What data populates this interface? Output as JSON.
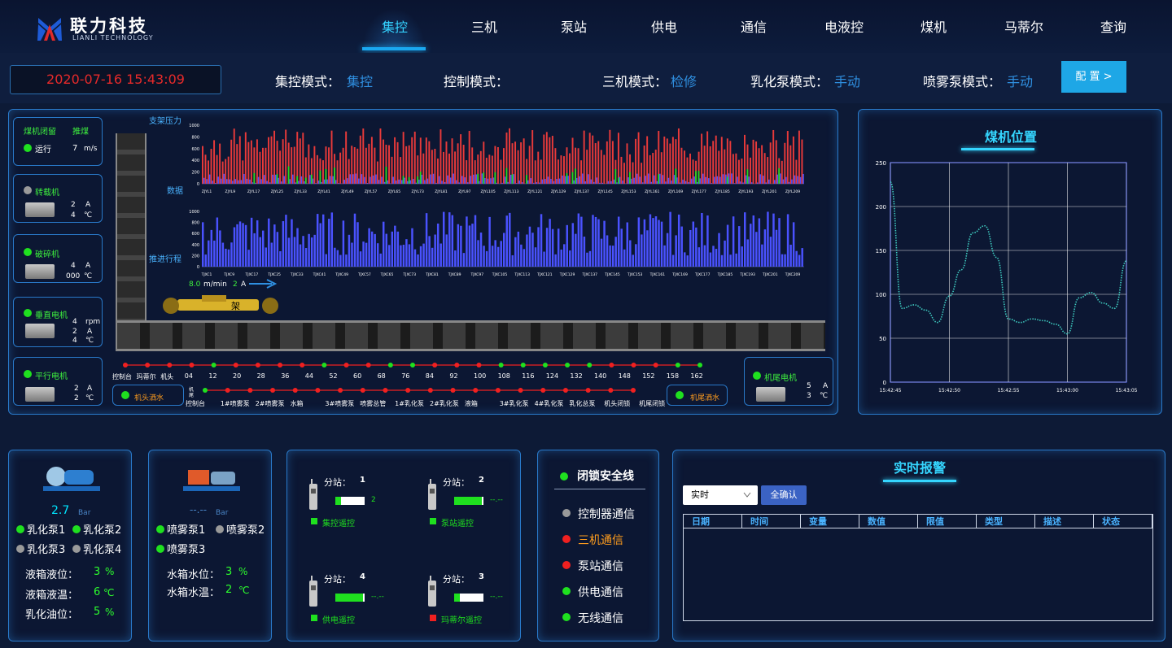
{
  "header": {
    "logo_cn": "联力科技",
    "logo_en": "LIANLI TECHNOLOGY",
    "nav": [
      "集控",
      "三机",
      "泵站",
      "供电",
      "通信",
      "电液控",
      "煤机",
      "马蒂尔",
      "查询"
    ],
    "active_nav": "集控"
  },
  "modebar": {
    "datetime": "2020-07-16 15:43:09",
    "modes": [
      {
        "label": "集控模式：",
        "value": "集控"
      },
      {
        "label": "控制模式：",
        "value": ""
      },
      {
        "label": "三机模式：",
        "value": "检修"
      },
      {
        "label": "乳化泵模式：",
        "value": "手动"
      },
      {
        "label": "喷雾泵模式：",
        "value": "手动"
      }
    ],
    "config_label": "配 置 >"
  },
  "left_cards": {
    "shearer": {
      "label1": "煤机闭留",
      "label2": "推煤",
      "status": "运行",
      "speed": "7",
      "speed_unit": "m/s"
    },
    "reloader": {
      "name": "转载机",
      "current": "2",
      "current_unit": "A",
      "temp": "4",
      "temp_unit": "℃"
    },
    "crusher": {
      "name": "破碎机",
      "current": "4",
      "current_unit": "A",
      "temp": "000",
      "temp_unit": "℃"
    },
    "vertical_motor": {
      "name": "垂直电机",
      "rpm": "4",
      "rpm_unit": "rpm",
      "current": "2",
      "current_unit": "A",
      "temp": "4",
      "temp_unit": "℃"
    },
    "parallel_motor": {
      "name": "平行电机",
      "current": "2",
      "current_unit": "A",
      "temp": "2",
      "temp_unit": "℃"
    },
    "tail_motor": {
      "name": "机尾电机",
      "current": "5",
      "current_unit": "A",
      "temp": "3",
      "temp_unit": "℃"
    }
  },
  "charts_center": {
    "pressure_title": "支架压力",
    "pressure_sub": "数据",
    "push_title": "推进行程",
    "pressure_yticks": [
      "1000",
      "800",
      "600",
      "400",
      "200",
      "0"
    ],
    "pressure_xticks": [
      "ZJYL1",
      "ZJYL9",
      "ZJYL17",
      "ZJYL25",
      "ZJYL33",
      "ZJYL41",
      "ZJYL49",
      "ZJYL57",
      "ZJYL65",
      "ZJYL73",
      "ZJYL81",
      "ZJYL97",
      "ZJYL105",
      "ZJYL113",
      "ZJYL121",
      "ZJYL129",
      "ZJYL137",
      "ZJYL145",
      "ZJYL153",
      "ZJYL161",
      "ZJYL169",
      "ZJYL177",
      "ZJYL185",
      "ZJYL193",
      "ZJYL201",
      "ZJYL209"
    ],
    "push_yticks": [
      "1000",
      "800",
      "600",
      "400",
      "200",
      "0"
    ],
    "push_xticks": [
      "TJXC1",
      "TJXC9",
      "TJXC17",
      "TJXC25",
      "TJXC33",
      "TJXC41",
      "TJXC49",
      "TJXC57",
      "TJXC65",
      "TJXC73",
      "TJXC81",
      "TJXC89",
      "TJXC97",
      "TJXC105",
      "TJXC113",
      "TJXC121",
      "TJXC129",
      "TJXC137",
      "TJXC145",
      "TJXC153",
      "TJXC161",
      "TJXC169",
      "TJXC177",
      "TJXC185",
      "TJXC193",
      "TJXC201",
      "TJXC209"
    ],
    "shearer_speed": "8.0",
    "shearer_speed_unit": "m/min",
    "shearer_current": "2",
    "shearer_current_unit": "A",
    "shearer_label": "架"
  },
  "conveyor": {
    "labels_row1": [
      "控制台",
      "玛蒂尔",
      "机头",
      "04",
      "12",
      "20",
      "28",
      "36",
      "44",
      "52",
      "60",
      "68",
      "76",
      "84",
      "92",
      "100",
      "108",
      "116",
      "124",
      "132",
      "140",
      "148",
      "152",
      "158",
      "162"
    ],
    "labels_row2": [
      "控制台",
      "1#喷雾泵",
      "2#喷雾泵",
      "水箱",
      "3#喷雾泵",
      "喷雾总管",
      "1#乳化泵",
      "2#乳化泵",
      "液箱",
      "3#乳化泵",
      "4#乳化泵",
      "乳化总泵",
      "机头闭锁",
      "机尾闭锁"
    ],
    "row1_dot_colors": [
      "#f02020",
      "#f02020",
      "#f02020",
      "#f02020",
      "#1fe01f",
      "#f02020",
      "#f02020",
      "#f02020",
      "#f02020",
      "#1fe01f",
      "#f02020",
      "#f02020",
      "#1fe01f",
      "#1fe01f",
      "#f02020",
      "#f02020",
      "#f02020",
      "#1fe01f",
      "#1fe01f",
      "#1fe01f",
      "#1fe01f",
      "#1fe01f",
      "#f02020",
      "#f02020",
      "#f02020",
      "#1fe01f",
      "#1fe01f"
    ],
    "row2_dot_colors": [
      "#1fe01f",
      "#f02020",
      "#f02020",
      "#f02020",
      "#f02020",
      "#f02020",
      "#f02020",
      "#f02020",
      "#f02020",
      "#f02020",
      "#f02020",
      "#f02020",
      "#f02020",
      "#f02020",
      "#f02020",
      "#f02020",
      "#f02020",
      "#f02020",
      "#f02020",
      "#f02020"
    ],
    "head_water": "机头洒水",
    "tail_water": "机尾洒水",
    "tiny_label": "机尾"
  },
  "shearer_position": {
    "title": "煤机位置",
    "chart_data": {
      "type": "line",
      "title": "煤机位置",
      "x": [
        "15:42:45",
        "15:42:46",
        "15:42:47",
        "15:42:48",
        "15:42:49",
        "15:42:50",
        "15:42:51",
        "15:42:52",
        "15:42:53",
        "15:42:54",
        "15:42:55",
        "15:42:56",
        "15:42:57",
        "15:42:58",
        "15:42:59",
        "15:43:00",
        "15:43:01",
        "15:43:02",
        "15:43:03",
        "15:43:04",
        "15:43:05"
      ],
      "xticks": [
        "15:42:45",
        "15:42:50",
        "15:42:55",
        "15:43:00",
        "15:43:05"
      ],
      "yticks": [
        "0",
        "50",
        "100",
        "150",
        "200",
        "250"
      ],
      "ylim": [
        0,
        250
      ],
      "series": [
        {
          "values": [
            228,
            84,
            88,
            82,
            68,
            98,
            128,
            170,
            178,
            142,
            72,
            68,
            72,
            70,
            66,
            55,
            96,
            102,
            90,
            84,
            138
          ]
        }
      ],
      "color": "#3ecbc0",
      "grid": true
    }
  },
  "emulsion_pump": {
    "pressure": "2.7",
    "pressure_unit": "Bar",
    "pumps": [
      {
        "name": "乳化泵1",
        "on": true
      },
      {
        "name": "乳化泵2",
        "on": true
      },
      {
        "name": "乳化泵3",
        "on": false
      },
      {
        "name": "乳化泵4",
        "on": false
      }
    ],
    "level_label": "液箱液位：",
    "level_value": "3",
    "level_unit": "%",
    "temp_label": "液箱液温：",
    "temp_value": "6",
    "temp_unit": "℃",
    "oil_label": "乳化油位：",
    "oil_value": "5",
    "oil_unit": "%"
  },
  "spray_pump": {
    "pressure": "--.--",
    "pressure_unit": "Bar",
    "pumps": [
      {
        "name": "喷雾泵1",
        "on": true
      },
      {
        "name": "喷雾泵2",
        "on": false
      },
      {
        "name": "喷雾泵3",
        "on": true
      }
    ],
    "water_level_label": "水箱水位：",
    "water_level_value": "3",
    "water_level_unit": "%",
    "water_temp_label": "水箱水温：",
    "water_temp_value": "2",
    "water_temp_unit": "℃"
  },
  "substations": [
    {
      "label": "分站：",
      "num": "1",
      "value": "2",
      "fill": 0.2,
      "remote": "集控遥控",
      "remote_color": "#1fe01f"
    },
    {
      "label": "分站：",
      "num": "2",
      "value": "--.--",
      "fill": 0.95,
      "remote": "泵站遥控",
      "remote_color": "#1fe01f"
    },
    {
      "label": "分站：",
      "num": "4",
      "value": "--.--",
      "fill": 0.95,
      "remote": "供电遥控",
      "remote_color": "#1fe01f"
    },
    {
      "label": "分站：",
      "num": "3",
      "value": "--.--",
      "fill": 0.2,
      "remote": "玛蒂尔遥控",
      "remote_color": "#f02020"
    }
  ],
  "lock_line": {
    "title": "闭锁安全线",
    "items": [
      {
        "label": "控制器通信",
        "color": "#9a9a9a",
        "text_color": "#ffffff"
      },
      {
        "label": "三机通信",
        "color": "#f02020",
        "text_color": "#ff9d1e"
      },
      {
        "label": "泵站通信",
        "color": "#f02020",
        "text_color": "#ffffff"
      },
      {
        "label": "供电通信",
        "color": "#1fe01f",
        "text_color": "#ffffff"
      },
      {
        "label": "无线通信",
        "color": "#1fe01f",
        "text_color": "#ffffff"
      }
    ]
  },
  "alarm": {
    "title": "实时报警",
    "select_value": "实时",
    "confirm_all": "全确认",
    "columns": [
      "日期",
      "时间",
      "变量",
      "数值",
      "限值",
      "类型",
      "描述",
      "状态"
    ]
  }
}
